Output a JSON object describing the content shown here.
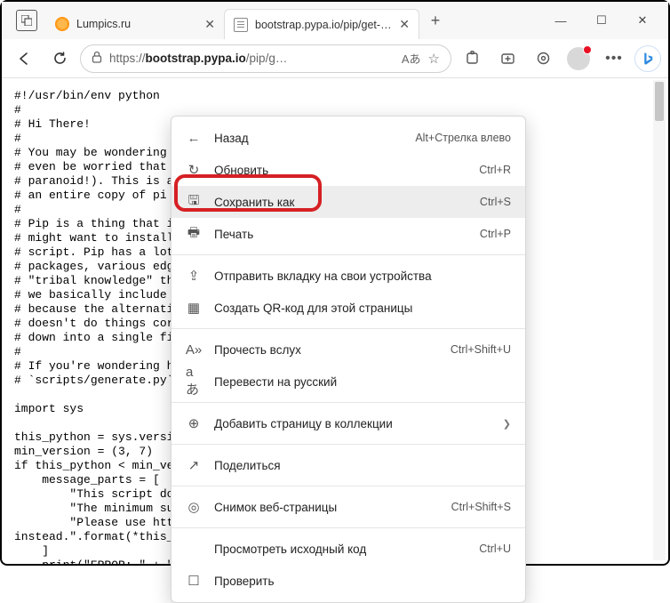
{
  "tabs": [
    {
      "label": "Lumpics.ru",
      "active": false
    },
    {
      "label": "bootstrap.pypa.io/pip/get-pi…",
      "active": true
    }
  ],
  "address": {
    "scheme": "https://",
    "host": "bootstrap.pypa.io",
    "path": "/pip/g…",
    "reader": "Aあ"
  },
  "code_lines": [
    "#!/usr/bin/env python",
    "#",
    "# Hi There!",
    "#",
    "# You may be wondering",
    "# even be worried that",
    "# paranoid!). This is a",
    "# an entire copy of pi",
    "#",
    "# Pip is a thing that i",
    "# might want to install",
    "# script. Pip has a lot",
    "# packages, various edg",
    "# \"tribal knowledge\" th",
    "# we basically include",
    "# because the alternati",
    "# doesn't do things cor",
    "# down into a single fi",
    "#",
    "# If you're wondering h",
    "# `scripts/generate.py`",
    "",
    "import sys",
    "",
    "this_python = sys.versi",
    "min_version = (3, 7)",
    "if this_python < min_ve",
    "    message_parts = [",
    "        \"This script do",
    "        \"The minimum su",
    "        \"Please use htt",
    "instead.\".format(*this_python)",
    "    ]",
    "    print(\"ERROR: \" + \" \".join(message_parts))"
  ],
  "context_menu": [
    {
      "icon": "←",
      "label": "Назад",
      "shortcut": "Alt+Стрелка влево",
      "name": "back"
    },
    {
      "icon": "↻",
      "label": "Обновить",
      "shortcut": "Ctrl+R",
      "name": "reload"
    },
    {
      "icon": "🖫",
      "label": "Сохранить как",
      "shortcut": "Ctrl+S",
      "name": "save-as",
      "hover": true
    },
    {
      "icon": "🖶",
      "label": "Печать",
      "shortcut": "Ctrl+P",
      "name": "print"
    },
    {
      "sep": true
    },
    {
      "icon": "⇪",
      "label": "Отправить вкладку на свои устройства",
      "name": "send-to-devices"
    },
    {
      "icon": "▦",
      "label": "Создать QR-код для этой страницы",
      "name": "create-qr"
    },
    {
      "sep": true
    },
    {
      "icon": "A»",
      "label": "Прочесть вслух",
      "shortcut": "Ctrl+Shift+U",
      "name": "read-aloud"
    },
    {
      "icon": "aあ",
      "label": "Перевести на русский",
      "name": "translate"
    },
    {
      "sep": true
    },
    {
      "icon": "⊕",
      "label": "Добавить страницу в коллекции",
      "submenu": true,
      "name": "add-to-collections"
    },
    {
      "sep": true
    },
    {
      "icon": "↗",
      "label": "Поделиться",
      "name": "share"
    },
    {
      "sep": true
    },
    {
      "icon": "◎",
      "label": "Снимок веб-страницы",
      "shortcut": "Ctrl+Shift+S",
      "name": "web-capture"
    },
    {
      "sep": true
    },
    {
      "icon": "",
      "label": "Просмотреть исходный код",
      "shortcut": "Ctrl+U",
      "name": "view-source"
    },
    {
      "icon": "☐",
      "label": "Проверить",
      "name": "inspect"
    }
  ]
}
